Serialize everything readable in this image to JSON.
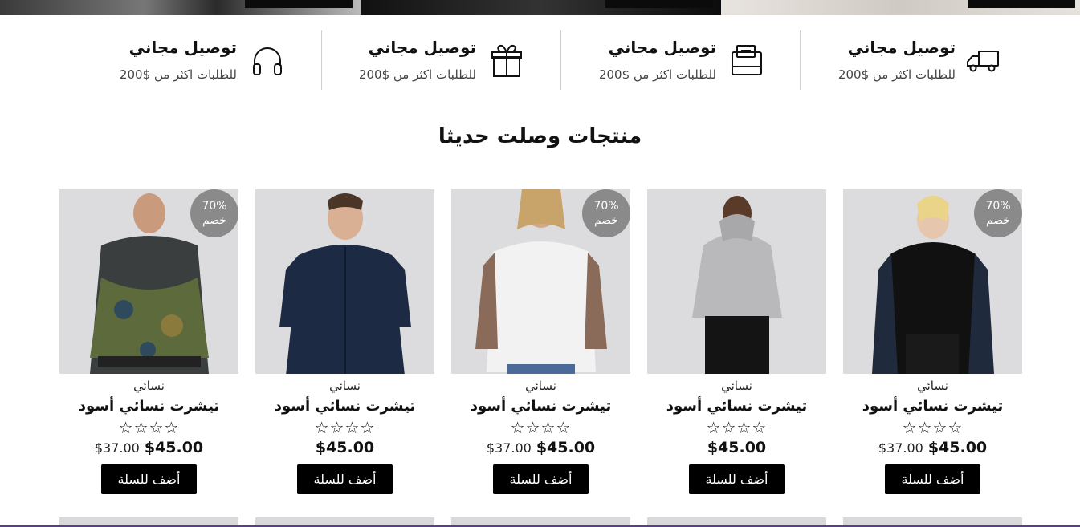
{
  "features": [
    {
      "title": "توصيل مجاني",
      "subtitle": "للطلبات اكثر من $200",
      "icon": "truck-icon"
    },
    {
      "title": "توصيل مجاني",
      "subtitle": "للطلبات اكثر من $200",
      "icon": "wallet-icon"
    },
    {
      "title": "توصيل مجاني",
      "subtitle": "للطلبات اكثر من $200",
      "icon": "gift-icon"
    },
    {
      "title": "توصيل مجاني",
      "subtitle": "للطلبات اكثر من $200",
      "icon": "headphones-icon"
    }
  ],
  "section_title": "منتجات وصلت حديثا",
  "products": [
    {
      "category": "نسائي",
      "name": "تيشرت نسائي أسود",
      "stars": "☆☆☆☆",
      "old_price": "$37.00",
      "price": "$45.00",
      "button": "أضف للسلة",
      "badge_top": "70%",
      "badge_bottom": "خصم",
      "photo": "black sequin sweatshirt"
    },
    {
      "category": "نسائي",
      "name": "تيشرت نسائي أسود",
      "stars": "☆☆☆☆",
      "old_price": "",
      "price": "$45.00",
      "button": "أضف للسلة",
      "badge_top": "",
      "badge_bottom": "",
      "photo": "grey hoodie crop top"
    },
    {
      "category": "نسائي",
      "name": "تيشرت نسائي أسود",
      "stars": "☆☆☆☆",
      "old_price": "$37.00",
      "price": "$45.00",
      "button": "أضف للسلة",
      "badge_top": "70%",
      "badge_bottom": "خصم",
      "photo": "white tshirt"
    },
    {
      "category": "نسائي",
      "name": "تيشرت نسائي أسود",
      "stars": "☆☆☆☆",
      "old_price": "",
      "price": "$45.00",
      "button": "أضف للسلة",
      "badge_top": "",
      "badge_bottom": "",
      "photo": "navy shirt"
    },
    {
      "category": "نسائي",
      "name": "تيشرت نسائي أسود",
      "stars": "☆☆☆☆",
      "old_price": "$37.00",
      "price": "$45.00",
      "button": "أضف للسلة",
      "badge_top": "70%",
      "badge_bottom": "خصم",
      "photo": "camo windbreaker"
    }
  ],
  "colors": {
    "badge": "#8a8a8a",
    "button": "#000000",
    "accent_line": "#5a3d8c"
  }
}
